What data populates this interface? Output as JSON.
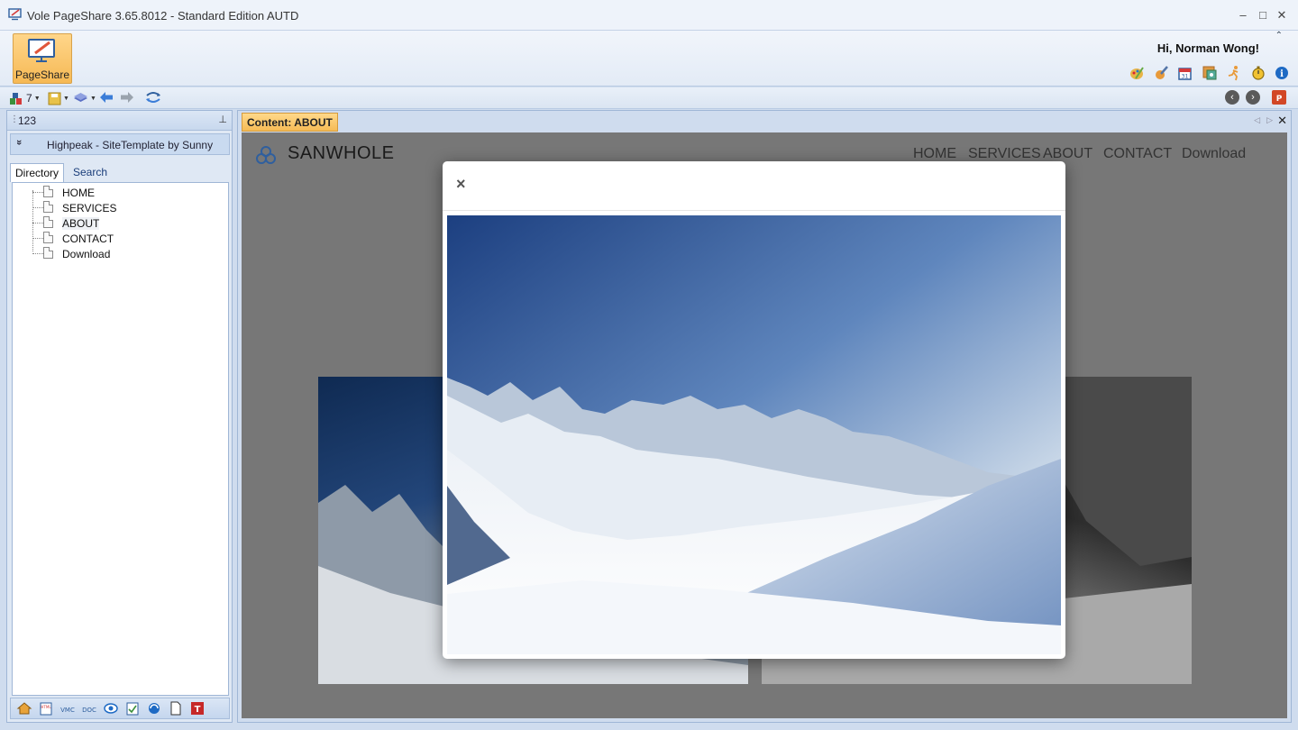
{
  "window": {
    "title": "Vole PageShare  3.65.8012 - Standard Edition AUTD",
    "minimize": "–",
    "maximize": "□",
    "close": "✕"
  },
  "ribbon": {
    "pageshare_label": "PageShare",
    "greeting": "Hi, Norman Wong!",
    "collapse": "⌃",
    "icons": [
      "paint-palette-icon",
      "brush-icon",
      "calendar-icon",
      "settings-panel-icon",
      "run-icon",
      "stopwatch-icon",
      "info-icon"
    ]
  },
  "toolbar": {
    "count": "7",
    "back_circle": "‹",
    "forward_circle": "›"
  },
  "left_panel": {
    "title": "123",
    "pin": "⊥",
    "site_chevron": "»",
    "site_name": "Highpeak - SiteTemplate by Sunny",
    "tabs": [
      "Directory",
      "Search"
    ],
    "tree": [
      "HOME",
      "SERVICES",
      "ABOUT",
      "CONTACT",
      "Download"
    ],
    "selected_item": "ABOUT"
  },
  "content": {
    "tab_prefix": "Content: ",
    "tab_value": "ABOUT",
    "tab_close": "✕"
  },
  "webpage": {
    "brand": "SANWHOLE",
    "nav": [
      "HOME",
      "SERVICES",
      "ABOUT",
      "CONTACT",
      "Download"
    ]
  },
  "modal": {
    "close": "×"
  },
  "colors": {
    "accent_orange": "#f6b955",
    "panel_blue": "#cfdcee",
    "logo_blue": "#2f5f9e"
  }
}
